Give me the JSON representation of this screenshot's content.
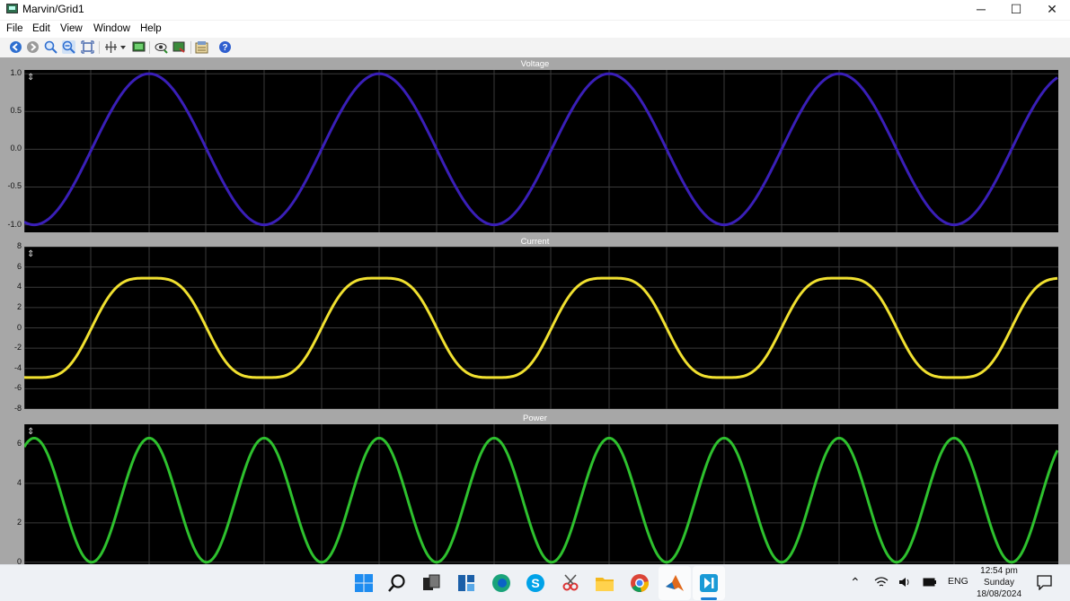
{
  "window": {
    "title": "Marvin/Grid1",
    "controls": {
      "minimize": "─",
      "maximize": "☐",
      "close": "✕"
    }
  },
  "menu": [
    "File",
    "Edit",
    "View",
    "Window",
    "Help"
  ],
  "toolbar": {
    "icons": [
      "back-icon",
      "forward-icon",
      "zoom-icon",
      "zoom-out-icon",
      "fit-icon",
      "crosshair-icon",
      "dropdown-icon",
      "display-icon",
      "eye-icon",
      "export-icon",
      "properties-icon",
      "help-icon"
    ]
  },
  "colors": {
    "voltage": "#3a1fb8",
    "current": "#f0e030",
    "power": "#2ec12e",
    "plot_bg": "#000000",
    "grid": "#3a3a3a"
  },
  "chart_data": [
    {
      "type": "line",
      "title": "Voltage",
      "ylim": [
        -1.1,
        1.05
      ],
      "xlim": [
        0,
        1151
      ],
      "yticks": [
        "1.0",
        "0.5",
        "0.0",
        "-0.5",
        "-1.0"
      ],
      "ytick_values": [
        1.0,
        0.5,
        0.0,
        -0.5,
        -1.0
      ],
      "series": [
        {
          "color": "#3a1fb8",
          "waveform": "sine",
          "amplitude": 1.0,
          "period": 256,
          "first_peak_x": 139
        }
      ]
    },
    {
      "type": "line",
      "title": "Current",
      "ylim": [
        -8,
        8
      ],
      "xlim": [
        0,
        1151
      ],
      "yticks": [
        "8",
        "6",
        "4",
        "2",
        "0",
        "-2",
        "-4",
        "-6",
        "-8"
      ],
      "ytick_values": [
        8,
        6,
        4,
        2,
        0,
        -2,
        -4,
        -6,
        -8
      ],
      "series": [
        {
          "color": "#f0e030",
          "waveform": "sine+3rd harmonic",
          "amplitude": 5.5,
          "harmonic_amplitude": 0.6,
          "period": 256,
          "first_peak_x": 139
        }
      ]
    },
    {
      "type": "line",
      "title": "Power",
      "ylim": [
        -0.1,
        7.0
      ],
      "xlim": [
        0,
        1151
      ],
      "yticks": [
        "6",
        "4",
        "2",
        "0"
      ],
      "ytick_values": [
        6,
        4,
        2,
        0
      ],
      "series": [
        {
          "color": "#2ec12e",
          "waveform": "rectified",
          "peak": 6.3,
          "period": 128,
          "first_peak_x": 11
        }
      ]
    }
  ],
  "taskbar": {
    "apps": [
      "windows-start-icon",
      "search-icon",
      "task-view-icon",
      "widgets-icon",
      "edge-icon",
      "skype-icon",
      "snipping-icon",
      "file-explorer-icon",
      "chrome-icon",
      "matlab-icon",
      "marvin-icon"
    ],
    "tray": {
      "language": "ENG"
    },
    "clock": {
      "time": "12:54 pm",
      "day": "Sunday",
      "date": "18/08/2024"
    }
  }
}
